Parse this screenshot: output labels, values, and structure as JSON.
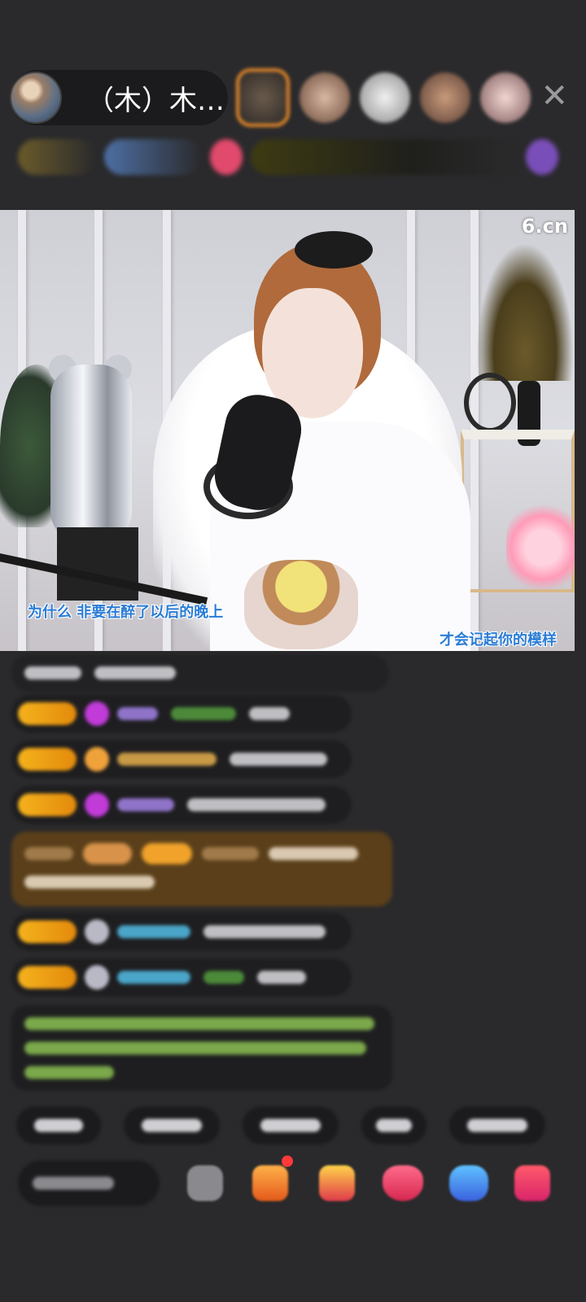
{
  "header": {
    "host_name": "（木）木…",
    "close_label": "✕"
  },
  "video": {
    "watermark": "6.cn",
    "subtitle_left": "为什么  非要在醉了以后的晚上",
    "subtitle_right": "才会记起你的模样"
  },
  "colors": {
    "background": "#2a2a2c",
    "badge_gold": "#f5b21c",
    "subtitle_blue": "#2a7cd6",
    "gift_highlight": "#6a4a1c"
  }
}
